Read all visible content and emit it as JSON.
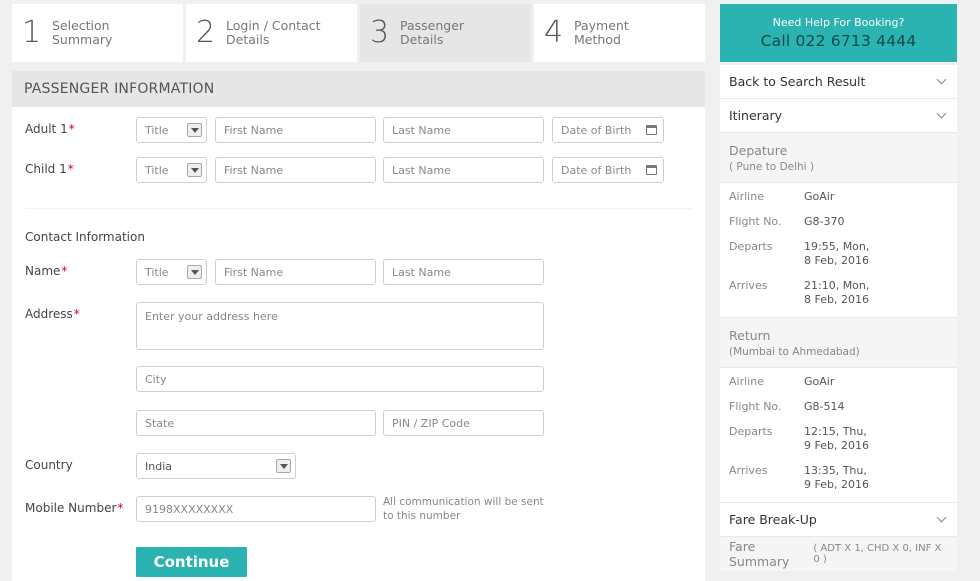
{
  "steps": [
    {
      "num": "1",
      "label_line1": "Selection",
      "label_line2": "Summary"
    },
    {
      "num": "2",
      "label_line1": "Login / Contact",
      "label_line2": "Details"
    },
    {
      "num": "3",
      "label_line1": "Passenger",
      "label_line2": "Details"
    },
    {
      "num": "4",
      "label_line1": "Payment",
      "label_line2": "Method"
    }
  ],
  "form": {
    "section_title": "PASSENGER INFORMATION",
    "adult_label": "Adult 1",
    "child_label": "Child 1",
    "required_mark": "*",
    "title_placeholder": "Title",
    "first_name_placeholder": "First Name",
    "last_name_placeholder": "Last Name",
    "dob_placeholder": "Date of Birth",
    "contact_heading": "Contact Information",
    "name_label": "Name",
    "address_label": "Address",
    "address_placeholder": "Enter your address here",
    "city_placeholder": "City",
    "state_placeholder": "State",
    "pin_placeholder": "PIN / ZIP Code",
    "country_label": "Country",
    "country_value": "India",
    "mobile_label": "Mobile Number",
    "mobile_placeholder": "9198XXXXXXXX",
    "mobile_hint": "All communication will be sent to this number",
    "continue_label": "Continue"
  },
  "sidebar": {
    "help_title": "Need Help For Booking?",
    "help_phone": "Call 022 6713 4444",
    "back_label": "Back to Search Result",
    "itinerary_label": "Itinerary",
    "departure": {
      "title": "Depature",
      "route": "( Pune to Delhi )",
      "airline_k": "Airline",
      "airline_v": "GoAir",
      "flight_k": "Flight No.",
      "flight_v": "G8-370",
      "departs_k": "Departs",
      "departs_v1": "19:55, Mon,",
      "departs_v2": "8 Feb, 2016",
      "arrives_k": "Arrives",
      "arrives_v1": "21:10, Mon,",
      "arrives_v2": "8 Feb, 2016"
    },
    "return": {
      "title": "Return",
      "route": "(Mumbai to Ahmedabad)",
      "airline_k": "Airline",
      "airline_v": "GoAir",
      "flight_k": "Flight No.",
      "flight_v": "G8-514",
      "departs_k": "Departs",
      "departs_v1": "12:15, Thu,",
      "departs_v2": "9 Feb, 2016",
      "arrives_k": "Arrives",
      "arrives_v1": "13:35, Thu,",
      "arrives_v2": "9 Feb, 2016"
    },
    "fare_breakup_label": "Fare Break-Up",
    "fare_summary_label": "Fare Summary",
    "fare_summary_detail": "( ADT X 1, CHD X 0, INF X 0 )"
  },
  "colors": {
    "accent": "#2ab3b0",
    "required": "#d0021b",
    "active_step": "#e6e6e6"
  },
  "icons": [
    "chevron-down-icon",
    "calendar-icon",
    "dropdown-caret-icon"
  ]
}
